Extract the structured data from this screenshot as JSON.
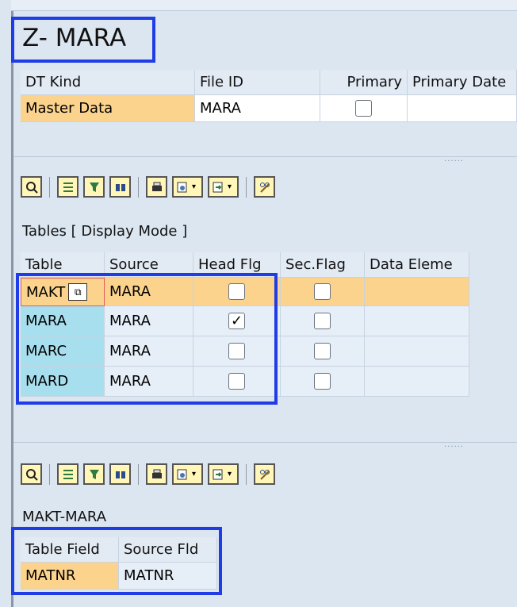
{
  "header": {
    "title": "Z- MARA"
  },
  "dt_table": {
    "headers": [
      "DT Kind",
      "File ID",
      "Primary",
      "Primary Date"
    ],
    "row": {
      "dt_kind": "Master Data",
      "file_id": "MARA",
      "primary_checked": false
    }
  },
  "section1": {
    "title": "Tables [ Display Mode ]",
    "headers": [
      "Table",
      "Source",
      "Head Flg",
      "Sec.Flag",
      "Data Eleme"
    ],
    "rows": [
      {
        "table": "MAKT",
        "source": "MARA",
        "head": false,
        "sec": false
      },
      {
        "table": "MARA",
        "source": "MARA",
        "head": true,
        "sec": false
      },
      {
        "table": "MARC",
        "source": "MARA",
        "head": false,
        "sec": false
      },
      {
        "table": "MARD",
        "source": "MARA",
        "head": false,
        "sec": false
      }
    ]
  },
  "section2": {
    "title": "MAKT-MARA",
    "headers": [
      "Table Field",
      "Source Fld"
    ],
    "rows": [
      {
        "field": "MATNR",
        "source": "MATNR"
      }
    ]
  },
  "toolbar": {
    "icons": [
      "details-icon",
      "sort-ascending-icon",
      "filter-icon",
      "find-icon",
      "print-icon",
      "export-icon",
      "layout-icon",
      "change-layout-icon"
    ]
  },
  "colors": {
    "accent_outline": "#1f3ce6",
    "selected_row": "#fbd38d",
    "key_cell": "#a8dfee",
    "toolbar_button": "#fff6b8"
  }
}
